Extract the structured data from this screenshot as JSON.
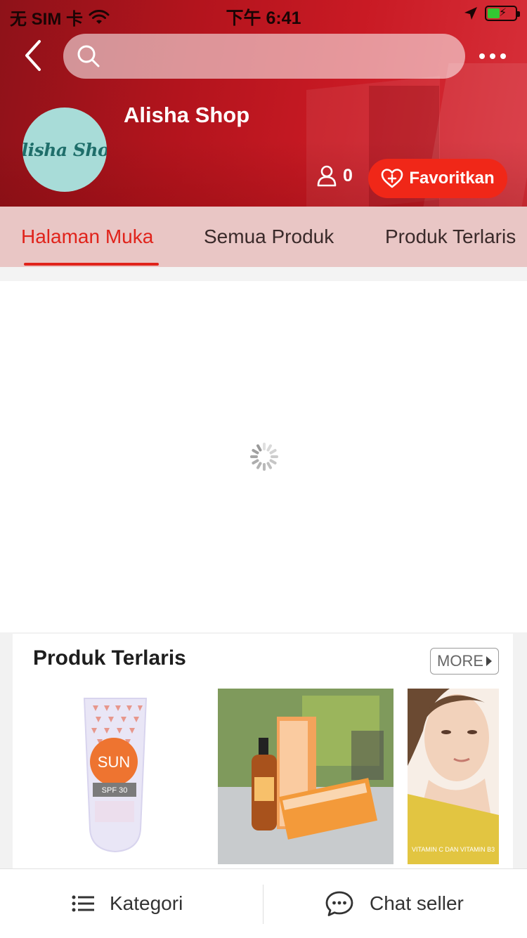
{
  "status_bar": {
    "carrier": "无 SIM 卡",
    "time": "下午 6:41",
    "battery_icon": "battery-charging-icon",
    "wifi_icon": "wifi-icon",
    "location_icon": "location-arrow-icon"
  },
  "nav": {
    "back_icon": "chevron-left-icon",
    "search_placeholder": "",
    "more_icon": "more-dots-icon"
  },
  "shop": {
    "avatar_text": "Alisha Shop",
    "name": "Alisha Shop",
    "follower_count": "0",
    "favorite_label": "Favoritkan"
  },
  "tabs": [
    {
      "label": "Halaman Muka",
      "active": true
    },
    {
      "label": "Semua Produk",
      "active": false
    },
    {
      "label": "Produk Terlaris",
      "active": false
    }
  ],
  "best_sellers": {
    "title": "Produk Terlaris",
    "more_label": "MORE",
    "products": [
      {
        "name": "sunscreen-tube",
        "pack_text_big": "SUN",
        "pack_text_small": "SPF 30"
      },
      {
        "name": "vitamin-c-serum-box"
      },
      {
        "name": "face-cream-model",
        "pack_text": "VITAMIN C DAN VITAMIN B3"
      }
    ]
  },
  "bottom_bar": {
    "category_label": "Kategori",
    "chat_label": "Chat seller"
  },
  "colors": {
    "brand_red": "#e0231b",
    "favorite_button": "#f02718",
    "tab_background": "#e9c6c5"
  }
}
